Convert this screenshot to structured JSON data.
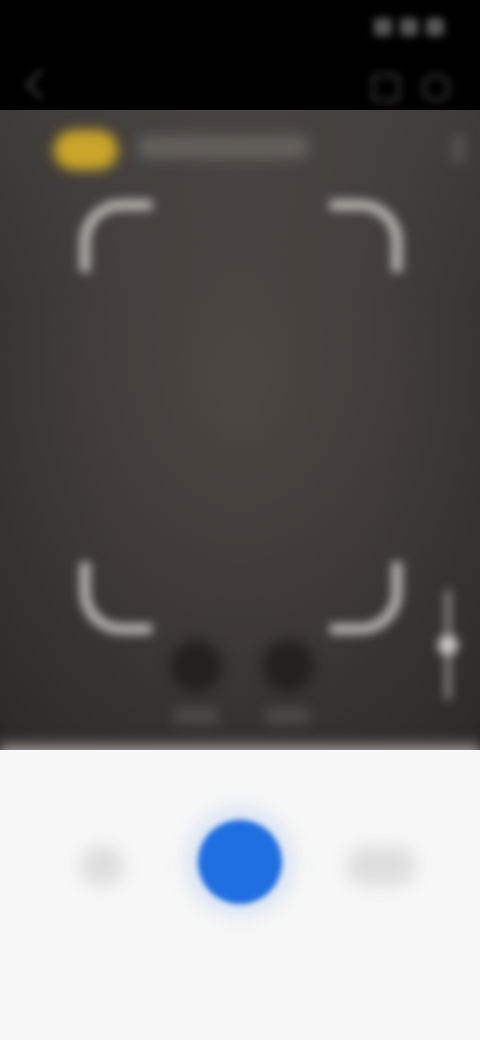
{
  "status_bar": {
    "time": ""
  },
  "top_toolbar": {
    "icons": [
      "back-icon",
      "layout-icon",
      "settings-icon"
    ]
  },
  "viewfinder": {
    "mode_chip_color": "#c9a52a",
    "chip_label": "",
    "frame_corner_color": "#bdbab6",
    "mode_buttons": [
      "",
      ""
    ],
    "zoom_level": 0.5
  },
  "controls": {
    "shutter_color": "#1f6fe0",
    "left_button_label": "",
    "right_button_label": ""
  }
}
